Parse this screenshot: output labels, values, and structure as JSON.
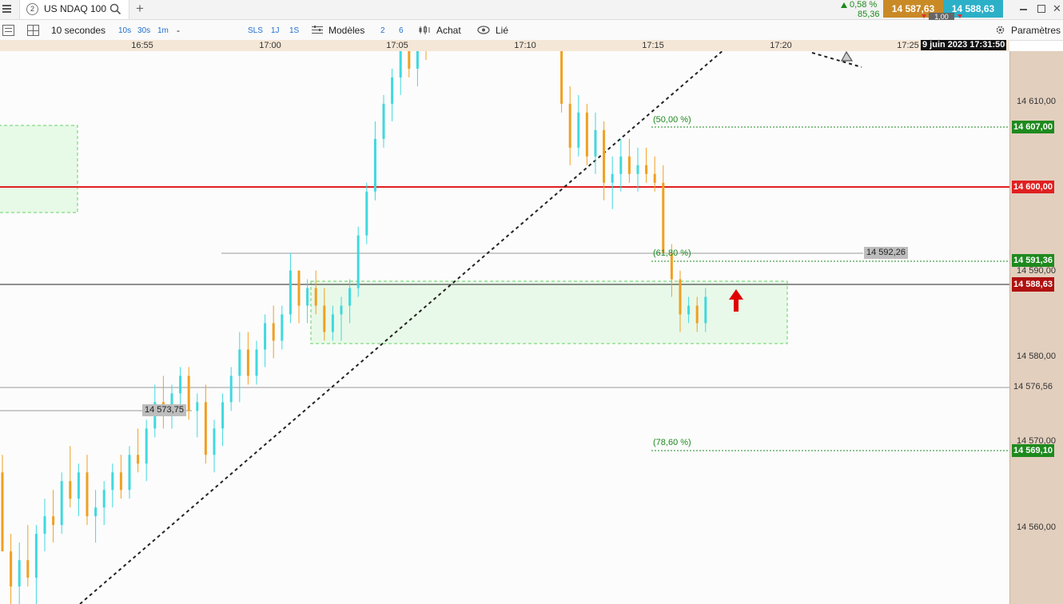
{
  "header": {
    "tab_number": "2",
    "instrument": "US NDAQ 100",
    "change_pct": "0,58 %",
    "change_abs": "85,36",
    "bid": "14 587,63",
    "ask": "14 588,63",
    "spread": "1,00",
    "add_tab": "+"
  },
  "toolbar": {
    "interval": "10 secondes",
    "quick_intervals": [
      "10s",
      "30s",
      "1m"
    ],
    "interval_dash": "-",
    "ranges": [
      "SLS",
      "1J",
      "1S"
    ],
    "models_label": "Modèles",
    "model_nums": [
      "2",
      "6"
    ],
    "buy_label": "Achat",
    "link_label": "Lié",
    "settings_label": "Paramètres"
  },
  "time_axis": {
    "ticks": [
      "16:55",
      "17:00",
      "17:05",
      "17:10",
      "17:15",
      "17:20",
      "17:25"
    ],
    "cursor_datetime": "9 juin 2023 17:31:50"
  },
  "price_axis": {
    "ticks": [
      "14 610,00",
      "14 590,00",
      "14 580,00",
      "14 576,56",
      "14 570,00",
      "14 560,00"
    ],
    "badges": [
      {
        "price": 14607.0,
        "label": "14 607,00",
        "color": "#1e8a1e"
      },
      {
        "price": 14600.0,
        "label": "14 600,00",
        "color": "#e02020"
      },
      {
        "price": 14591.36,
        "label": "14 591,36",
        "color": "#1e8a1e"
      },
      {
        "price": 14588.63,
        "label": "14 588,63",
        "color": "#b01010"
      },
      {
        "price": 14569.1,
        "label": "14 569,10",
        "color": "#1e8a1e"
      }
    ]
  },
  "annotations": {
    "fib_50": "(50,00 %)",
    "fib_618": "(61,80 %)",
    "fib_786": "(78,60 %)",
    "level_left": "14 573,75",
    "level_right": "14 592,26"
  },
  "colors": {
    "up_candle": "#3fd9de",
    "down_candle": "#f0a020",
    "support_line": "#e02020",
    "fib_green": "#1e8a1e",
    "bid_box": "#c98a26",
    "ask_box": "#2bb0c8"
  },
  "chart_data": {
    "type": "candlestick",
    "instrument": "US NDAQ 100",
    "interval": "10 secondes",
    "y_range": [
      14553,
      14616
    ],
    "x_range": [
      "16:52",
      "17:25"
    ],
    "horizontal_levels": [
      14607.0,
      14600.0,
      14592.26,
      14591.36,
      14588.63,
      14576.56,
      14573.75,
      14569.1
    ],
    "last_price": 14588.63,
    "fibonacci": [
      {
        "label": "(50,00 %)",
        "price": 14607.0
      },
      {
        "label": "(61,80 %)",
        "price": 14591.36
      },
      {
        "label": "(78,60 %)",
        "price": 14569.1
      }
    ],
    "candles_t": [
      [
        0,
        14568,
        14570,
        14560,
        14559
      ],
      [
        1,
        14559,
        14561,
        14553,
        14555
      ],
      [
        2,
        14555,
        14560,
        14551,
        14558
      ],
      [
        3,
        14558,
        14562,
        14555,
        14556
      ],
      [
        4,
        14556,
        14562,
        14552,
        14561
      ],
      [
        5,
        14561,
        14565,
        14559,
        14563
      ],
      [
        6,
        14563,
        14566,
        14560,
        14562
      ],
      [
        7,
        14562,
        14568,
        14561,
        14567
      ],
      [
        8,
        14567,
        14571,
        14564,
        14565
      ],
      [
        9,
        14565,
        14569,
        14563,
        14568
      ],
      [
        10,
        14568,
        14570,
        14562,
        14563
      ],
      [
        11,
        14563,
        14566,
        14560,
        14564
      ],
      [
        12,
        14564,
        14567,
        14562,
        14566
      ],
      [
        13,
        14566,
        14569,
        14564,
        14568
      ],
      [
        14,
        14568,
        14570,
        14565,
        14566
      ],
      [
        15,
        14566,
        14571,
        14565,
        14570
      ],
      [
        16,
        14570,
        14573,
        14568,
        14569
      ],
      [
        17,
        14569,
        14574,
        14567,
        14573
      ],
      [
        18,
        14573,
        14578,
        14572,
        14576
      ],
      [
        19,
        14576,
        14579,
        14573,
        14575
      ],
      [
        20,
        14575,
        14578,
        14573,
        14577
      ],
      [
        21,
        14577,
        14580,
        14575,
        14579
      ],
      [
        22,
        14579,
        14580,
        14574,
        14575
      ],
      [
        23,
        14575,
        14577,
        14572,
        14576
      ],
      [
        24,
        14576,
        14578,
        14569,
        14570
      ],
      [
        25,
        14570,
        14574,
        14568,
        14573
      ],
      [
        26,
        14573,
        14577,
        14571,
        14576
      ],
      [
        27,
        14576,
        14580,
        14575,
        14579
      ],
      [
        28,
        14579,
        14584,
        14576,
        14582
      ],
      [
        29,
        14582,
        14584,
        14578,
        14579
      ],
      [
        30,
        14579,
        14583,
        14578,
        14582
      ],
      [
        31,
        14582,
        14586,
        14580,
        14585
      ],
      [
        32,
        14585,
        14587,
        14581,
        14583
      ],
      [
        33,
        14583,
        14587,
        14582,
        14586
      ],
      [
        34,
        14586,
        14593,
        14585,
        14591
      ],
      [
        35,
        14591,
        14591,
        14585,
        14587
      ],
      [
        36,
        14587,
        14590,
        14585,
        14589
      ],
      [
        37,
        14589,
        14591,
        14586,
        14587
      ],
      [
        38,
        14587,
        14589,
        14583,
        14584
      ],
      [
        39,
        14584,
        14587,
        14583,
        14586
      ],
      [
        40,
        14586,
        14588,
        14583,
        14587
      ],
      [
        41,
        14587,
        14590,
        14585,
        14589
      ],
      [
        42,
        14589,
        14596,
        14588,
        14595
      ],
      [
        43,
        14595,
        14601,
        14594,
        14600
      ],
      [
        44,
        14600,
        14608,
        14599,
        14606
      ],
      [
        45,
        14606,
        14611,
        14605,
        14610
      ],
      [
        46,
        14610,
        14614,
        14608,
        14613
      ],
      [
        47,
        14613,
        14617,
        14611,
        14616
      ],
      [
        48,
        14616,
        14618,
        14613,
        14614
      ],
      [
        49,
        14614,
        14618,
        14612,
        14617
      ],
      [
        50,
        14617,
        14619,
        14615,
        14616
      ],
      [
        66,
        14616,
        14616,
        14609,
        14610
      ],
      [
        67,
        14610,
        14612,
        14603,
        14605
      ],
      [
        68,
        14605,
        14611,
        14604,
        14609
      ],
      [
        69,
        14609,
        14610,
        14603,
        14604
      ],
      [
        70,
        14604,
        14609,
        14602,
        14607
      ],
      [
        71,
        14607,
        14608,
        14599,
        14601
      ],
      [
        72,
        14601,
        14604,
        14598,
        14602
      ],
      [
        73,
        14602,
        14606,
        14600,
        14604
      ],
      [
        74,
        14604,
        14606,
        14601,
        14602
      ],
      [
        75,
        14602,
        14605,
        14600,
        14603
      ],
      [
        76,
        14603,
        14605,
        14601,
        14602
      ],
      [
        77,
        14602,
        14604,
        14600,
        14601
      ],
      [
        78,
        14601,
        14603,
        14596,
        14593
      ],
      [
        79,
        14593,
        14594,
        14588,
        14590
      ],
      [
        80,
        14590,
        14591,
        14584,
        14586
      ],
      [
        81,
        14586,
        14588,
        14585,
        14587
      ],
      [
        82,
        14587,
        14588,
        14584,
        14585
      ],
      [
        83,
        14585,
        14589,
        14584,
        14588
      ]
    ]
  }
}
